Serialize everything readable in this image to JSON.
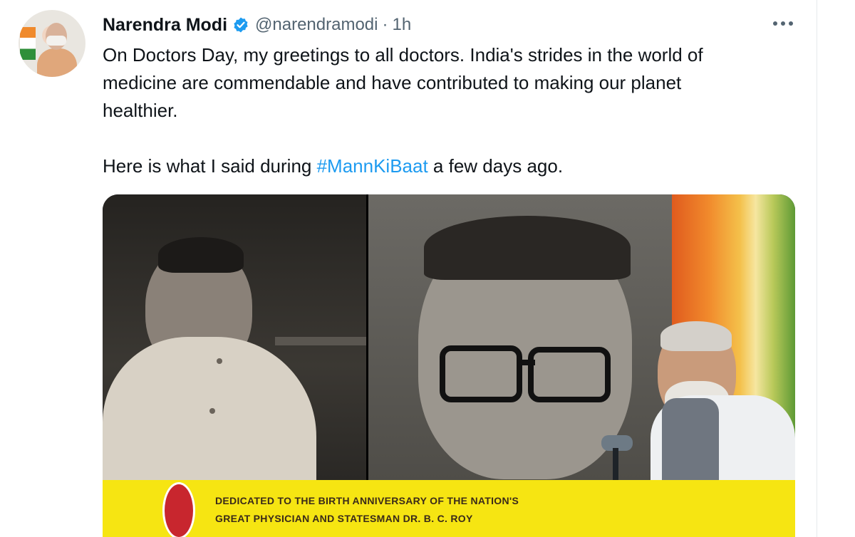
{
  "tweet": {
    "author": {
      "name": "Narendra Modi",
      "handle": "@narendramodi",
      "verified": true,
      "time": "1h",
      "separator": "·"
    },
    "text": {
      "line1": "On Doctors Day, my greetings to all doctors. India's strides in the world of",
      "line2": "medicine are commendable and have contributed to making our planet",
      "line3": "healthier.",
      "line4_before": "Here is what I said during ",
      "hashtag": "#MannKiBaat",
      "line4_after": " a few days ago."
    },
    "media": {
      "banner_line1": "DEDICATED TO THE BIRTH ANNIVERSARY OF THE NATION'S",
      "banner_line2": "GREAT PHYSICIAN AND STATESMAN DR. B. C. ROY"
    }
  },
  "colors": {
    "text": "#0f1419",
    "secondary": "#536471",
    "link": "#1d9bf0",
    "verified": "#1d9bf0",
    "banner": "#f6e512"
  },
  "icons": [
    "verified-badge-icon",
    "more-options-icon"
  ]
}
